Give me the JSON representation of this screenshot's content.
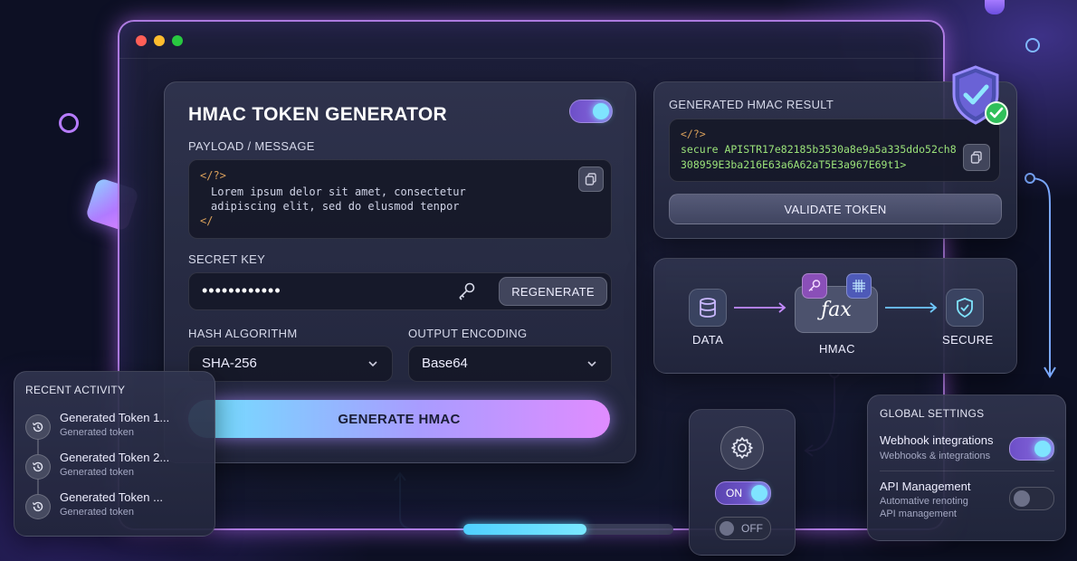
{
  "generator": {
    "title": "HMAC TOKEN GENERATOR",
    "toggle_on": true,
    "payload_label": "PAYLOAD / MESSAGE",
    "payload_lines": [
      "</?>",
      "Lorem ipsum delor sit amet, consectetur",
      "adipiscing elit, sed do elusmod tenpor",
      "</"
    ],
    "secret_label": "SECRET KEY",
    "secret_value": "••••••••••••",
    "regenerate_label": "REGENERATE",
    "hash_label": "HASH ALGORITHM",
    "hash_value": "SHA-256",
    "encoding_label": "OUTPUT ENCODING",
    "encoding_value": "Base64",
    "generate_label": "GENERATE HMAC"
  },
  "result": {
    "title": "GENERATED HMAC RESULT",
    "code_open": "</?>",
    "line1": "secure APISTR17e82185b3530a8e9a5a335ddo52ch8",
    "line2": "308959E3ba216E63a6A62aT5E3a967E69t1>",
    "validate_label": "VALIDATE TOKEN"
  },
  "flow": {
    "data_label": "DATA",
    "hmac_label": "HMAC",
    "hmac_symbol": "ƒax",
    "secure_label": "SECURE"
  },
  "activity": {
    "title": "RECENT ACTIVITY",
    "items": [
      {
        "title": "Generated Token 1...",
        "sub": "Generated token"
      },
      {
        "title": "Generated Token 2...",
        "sub": "Generated token"
      },
      {
        "title": "Generated Token ...",
        "sub": "Generated token"
      }
    ]
  },
  "power": {
    "on_label": "ON",
    "off_label": "OFF"
  },
  "settings": {
    "title": "GLOBAL SETTINGS",
    "items": [
      {
        "title": "Webhook integrations",
        "sub": "Webhooks & integrations",
        "enabled": true
      },
      {
        "title": "API Management",
        "sub": "Automative renoting",
        "sub2": "API management",
        "enabled": false
      }
    ]
  },
  "colors": {
    "accent_cyan": "#6fe3ff",
    "accent_purple": "#c77dff",
    "code_green": "#9be37a",
    "shield_check": "#2fbf5a"
  }
}
